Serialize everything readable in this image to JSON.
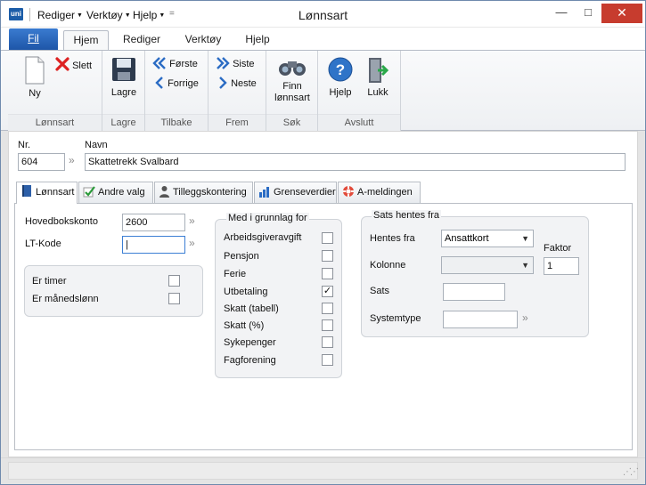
{
  "quick": {
    "logo": "uni",
    "menu1": "Rediger",
    "menu2": "Verktøy",
    "menu3": "Hjelp",
    "more": "="
  },
  "window": {
    "title": "Lønnsart",
    "minimize": "—",
    "maximize": "□",
    "close": "✕"
  },
  "ribbon_tabs": {
    "file": "Fil",
    "tab1": "Hjem",
    "tab2": "Rediger",
    "tab3": "Verktøy",
    "tab4": "Hjelp"
  },
  "ribbon": {
    "lonnsart": {
      "label": "Lønnsart",
      "ny": "Ny",
      "slett": "Slett"
    },
    "lagre": {
      "label": "Lagre",
      "lagre": "Lagre"
    },
    "tilbake": {
      "label": "Tilbake",
      "forste": "Første",
      "forrige": "Forrige"
    },
    "frem": {
      "label": "Frem",
      "siste": "Siste",
      "neste": "Neste"
    },
    "sok": {
      "label": "Søk",
      "finn1": "Finn",
      "finn2": "lønnsart"
    },
    "avslutt": {
      "label": "Avslutt",
      "hjelp": "Hjelp",
      "lukk": "Lukk"
    }
  },
  "header": {
    "nr_label": "Nr.",
    "nr_value": "604",
    "navn_label": "Navn",
    "navn_value": "Skattetrekk Svalbard"
  },
  "form_tabs": {
    "t1": "Lønnsart",
    "t2": "Andre valg",
    "t3": "Tilleggskontering",
    "t4": "Grenseverdier",
    "t5": "A-meldingen"
  },
  "lonnsart_tab": {
    "hovedbokskonto_label": "Hovedbokskonto",
    "hovedbokskonto_value": "2600",
    "ltkode_label": "LT-Kode",
    "ltkode_value": "|",
    "er_timer": "Er timer",
    "er_manedslonn": "Er månedslønn",
    "grunnlag_title": "Med i grunnlag for",
    "grunnlag": [
      {
        "label": "Arbeidsgiveravgift",
        "checked": false
      },
      {
        "label": "Pensjon",
        "checked": false
      },
      {
        "label": "Ferie",
        "checked": false
      },
      {
        "label": "Utbetaling",
        "checked": true
      },
      {
        "label": "Skatt (tabell)",
        "checked": false
      },
      {
        "label": "Skatt (%)",
        "checked": false
      },
      {
        "label": "Sykepenger",
        "checked": false
      },
      {
        "label": "Fagforening",
        "checked": false
      }
    ],
    "sats_title": "Sats hentes fra",
    "hentes_fra_label": "Hentes fra",
    "hentes_fra_value": "Ansattkort",
    "faktor_label": "Faktor",
    "faktor_value": "1",
    "kolonne_label": "Kolonne",
    "kolonne_value": "",
    "sats_label": "Sats",
    "sats_value": "",
    "systemtype_label": "Systemtype",
    "systemtype_value": ""
  },
  "arrow_glyph": "»",
  "check_glyph": "✓",
  "colors": {
    "file_tab": "#1e56a8",
    "close_button": "#c73c2e",
    "accent": "#2b6cc4"
  }
}
